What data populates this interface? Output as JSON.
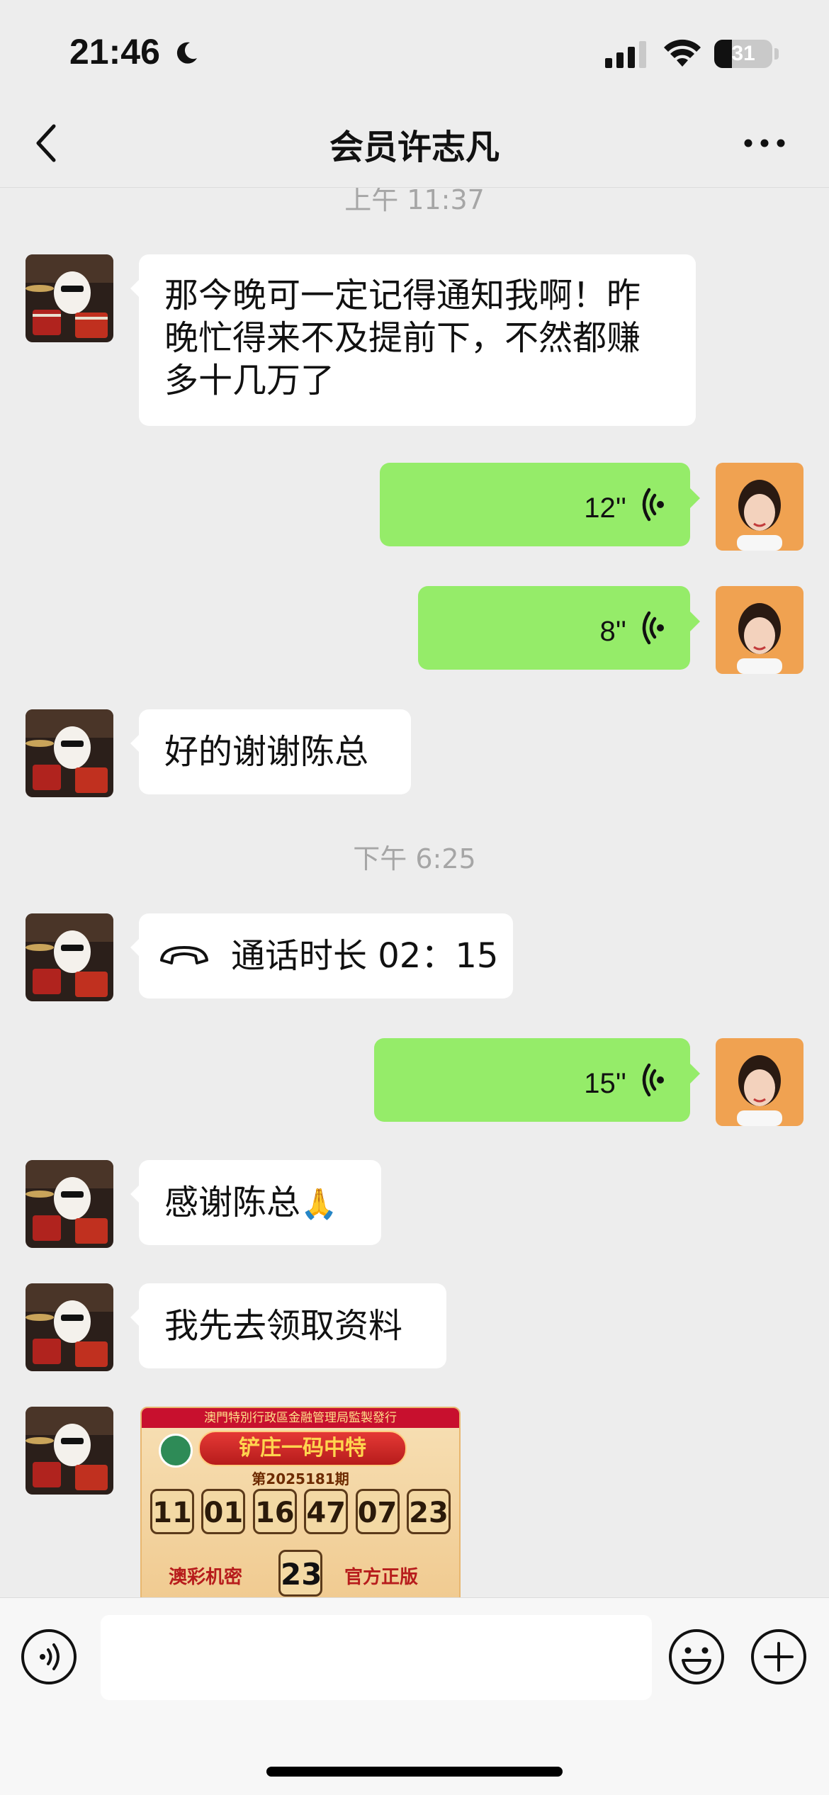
{
  "status_bar": {
    "time": "21:46",
    "battery": "31",
    "battery_level": 0.31
  },
  "nav": {
    "title": "会员许志凡"
  },
  "messages": {
    "ts1": "上午 11:37",
    "m1": [
      "那今晚可一定记得通知我啊！昨",
      "晚忙得来不及提前下，不然都赚",
      "多十几万了"
    ],
    "v1": "12''",
    "v2": "8''",
    "m2": "好的谢谢陈总",
    "ts2": "下午 6:25",
    "call": "通话时长 02：15",
    "v3": "15''",
    "m3": "感谢陈总",
    "m3_emoji": "🙏",
    "m4": "我先去领取资料",
    "lottery": {
      "header": "澳門特別行政區金融管理局監製發行",
      "title": "铲庄一码中特",
      "issue": "第2025181期",
      "numbers": [
        "11",
        "01",
        "16",
        "47",
        "07",
        "23"
      ],
      "special": "23",
      "label_left": "澳彩机密",
      "label_right": "官方正版"
    }
  },
  "input": {
    "placeholder": ""
  }
}
